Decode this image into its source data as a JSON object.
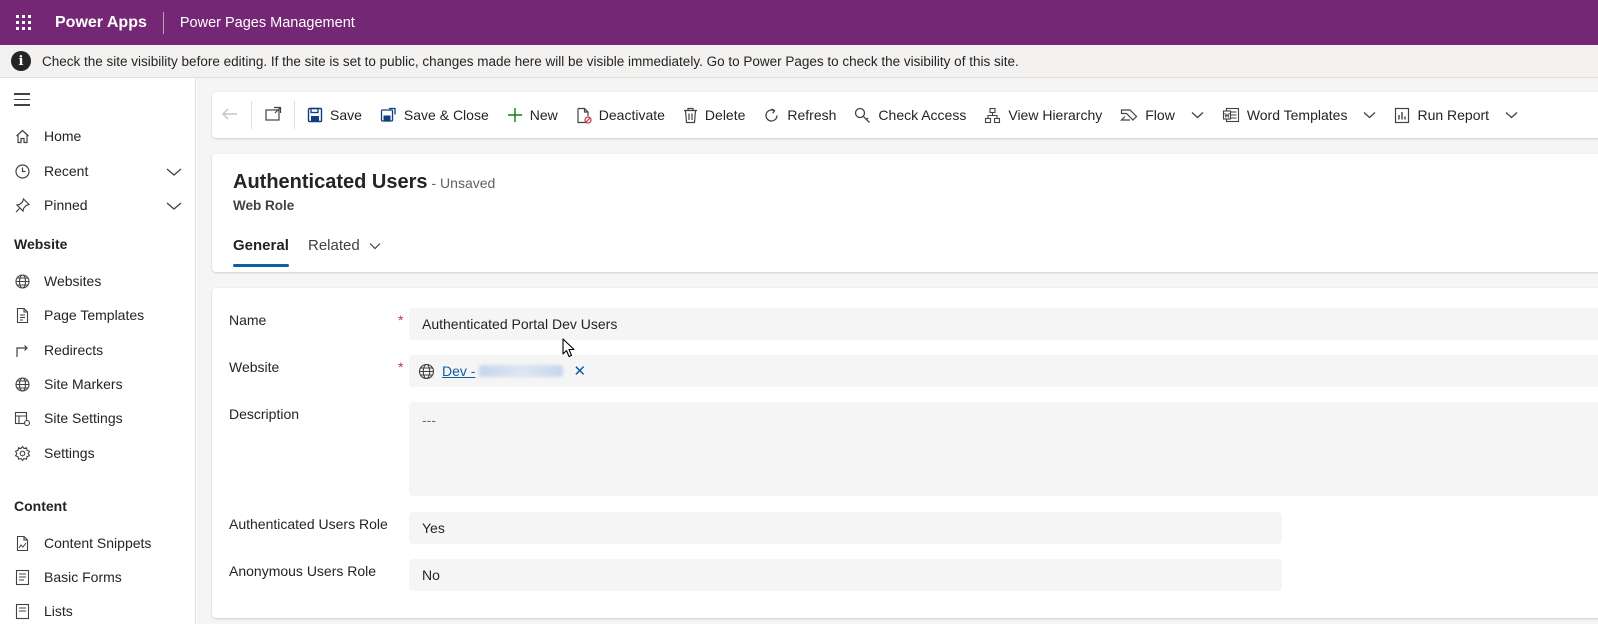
{
  "header": {
    "brand": "Power Apps",
    "app_name": "Power Pages Management"
  },
  "notification": {
    "icon": "info-icon",
    "text": "Check the site visibility before editing. If the site is set to public, changes made here will be visible immediately. Go to Power Pages to check the visibility of this site."
  },
  "sidebar": {
    "items_top": [
      {
        "label": "Home",
        "icon": "home-icon"
      },
      {
        "label": "Recent",
        "icon": "clock-icon"
      },
      {
        "label": "Pinned",
        "icon": "pin-icon"
      }
    ],
    "section_website": "Website",
    "website_items": [
      {
        "label": "Websites",
        "icon": "globe-icon"
      },
      {
        "label": "Page Templates",
        "icon": "page-icon"
      },
      {
        "label": "Redirects",
        "icon": "redirect-icon"
      },
      {
        "label": "Site Markers",
        "icon": "globe-icon"
      },
      {
        "label": "Site Settings",
        "icon": "settings-table-icon"
      },
      {
        "label": "Settings",
        "icon": "gear-icon"
      }
    ],
    "section_content": "Content",
    "content_items": [
      {
        "label": "Content Snippets",
        "icon": "snippet-icon"
      },
      {
        "label": "Basic Forms",
        "icon": "form-icon"
      },
      {
        "label": "Lists",
        "icon": "list-icon"
      }
    ]
  },
  "commandbar": {
    "save": "Save",
    "save_close": "Save & Close",
    "new": "New",
    "deactivate": "Deactivate",
    "delete": "Delete",
    "refresh": "Refresh",
    "check_access": "Check Access",
    "view_hierarchy": "View Hierarchy",
    "flow": "Flow",
    "word_templates": "Word Templates",
    "run_report": "Run Report"
  },
  "record": {
    "title": "Authenticated Users",
    "status": "- Unsaved",
    "entity": "Web Role",
    "tabs": [
      "General",
      "Related"
    ]
  },
  "form": {
    "name_label": "Name",
    "name_value": "Authenticated Portal Dev Users",
    "website_label": "Website",
    "website_value": "Dev -",
    "description_label": "Description",
    "description_value": "---",
    "auth_role_label": "Authenticated Users Role",
    "auth_role_value": "Yes",
    "anon_role_label": "Anonymous Users Role",
    "anon_role_value": "No",
    "required_marker": "*"
  },
  "colors": {
    "header_bg": "#742774",
    "link": "#115ea3",
    "required": "#c4314b"
  }
}
